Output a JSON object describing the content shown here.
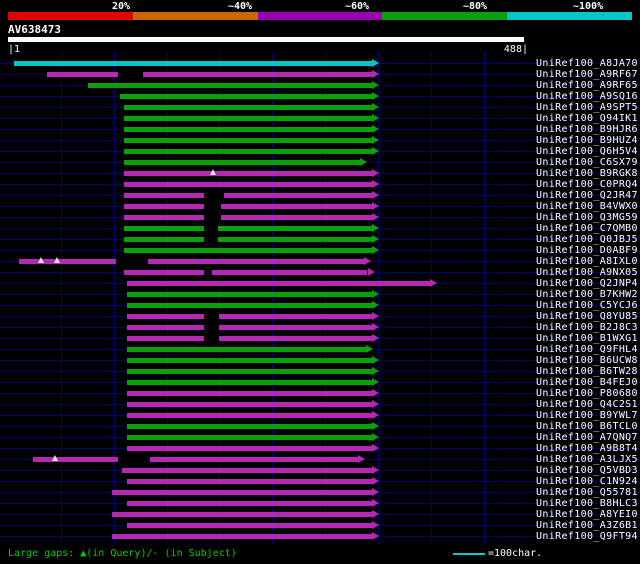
{
  "scale": {
    "labels": [
      "20%",
      "~40%",
      "~60%",
      "~80%",
      "~100%"
    ],
    "colors": [
      "#e00000",
      "#cc6600",
      "#9900b4",
      "#0aa00a",
      "#00c8c8"
    ]
  },
  "query": {
    "id": "AV638473",
    "ruler_left": "|1",
    "ruler_right": "488|"
  },
  "legend": {
    "gaps_note": "Large gaps: ▲(in Query)/- (in Subject)",
    "unit": "=100char."
  },
  "chart_data": {
    "type": "bar",
    "orientation": "horizontal",
    "title": "",
    "xlabel": "",
    "xlim": [
      0,
      488
    ],
    "bar_colors": {
      "cyan": "#00c8c8",
      "magenta": "#b428b4",
      "green": "#0aa00a"
    },
    "rows": [
      {
        "name": "UniRef100_A8JA70",
        "color": "cyan",
        "start": 6,
        "end": 344
      },
      {
        "name": "UniRef100_A9RF67",
        "color": "magenta",
        "start": 37,
        "end": 344,
        "gaps": [
          [
            104,
            128
          ]
        ]
      },
      {
        "name": "UniRef100_A9RF65",
        "color": "green",
        "start": 76,
        "end": 344
      },
      {
        "name": "UniRef100_A9SQ16",
        "color": "green",
        "start": 106,
        "end": 344
      },
      {
        "name": "UniRef100_A9SPT5",
        "color": "green",
        "start": 110,
        "end": 344
      },
      {
        "name": "UniRef100_Q94IK1",
        "color": "green",
        "start": 110,
        "end": 344
      },
      {
        "name": "UniRef100_B9HJR6",
        "color": "green",
        "start": 110,
        "end": 344
      },
      {
        "name": "UniRef100_B9HUZ4",
        "color": "green",
        "start": 110,
        "end": 344
      },
      {
        "name": "UniRef100_Q6H5V4",
        "color": "green",
        "start": 110,
        "end": 344
      },
      {
        "name": "UniRef100_C6SX79",
        "color": "green",
        "start": 110,
        "end": 333
      },
      {
        "name": "UniRef100_B9RGK8",
        "color": "magenta",
        "start": 110,
        "end": 344,
        "marks": [
          194
        ]
      },
      {
        "name": "UniRef100_C0PRQ4",
        "color": "magenta",
        "start": 110,
        "end": 344
      },
      {
        "name": "UniRef100_Q2JR47",
        "color": "magenta",
        "start": 110,
        "end": 344,
        "gaps": [
          [
            185,
            204
          ]
        ]
      },
      {
        "name": "UniRef100_B4VWX0",
        "color": "magenta",
        "start": 110,
        "end": 344,
        "gaps": [
          [
            185,
            201
          ]
        ]
      },
      {
        "name": "UniRef100_Q3MG59",
        "color": "magenta",
        "start": 110,
        "end": 344,
        "gaps": [
          [
            185,
            201
          ]
        ]
      },
      {
        "name": "UniRef100_C7QMB0",
        "color": "green",
        "start": 110,
        "end": 344,
        "gaps": [
          [
            185,
            199
          ]
        ]
      },
      {
        "name": "UniRef100_Q0JBJ5",
        "color": "green",
        "start": 110,
        "end": 344,
        "gaps": [
          [
            185,
            199
          ]
        ]
      },
      {
        "name": "UniRef100_D0ABF9",
        "color": "green",
        "start": 110,
        "end": 344
      },
      {
        "name": "UniRef100_A8IXL0",
        "color": "magenta",
        "start": 10,
        "end": 337,
        "gaps": [
          [
            102,
            132
          ]
        ],
        "marks": [
          31,
          46
        ]
      },
      {
        "name": "UniRef100_A9NX05",
        "color": "magenta",
        "start": 110,
        "end": 340,
        "gaps": [
          [
            185,
            193
          ]
        ]
      },
      {
        "name": "UniRef100_Q2JNP4",
        "color": "magenta",
        "start": 113,
        "end": 399
      },
      {
        "name": "UniRef100_B7KHW2",
        "color": "green",
        "start": 113,
        "end": 344
      },
      {
        "name": "UniRef100_C5YCJ6",
        "color": "green",
        "start": 113,
        "end": 344
      },
      {
        "name": "UniRef100_Q8YU85",
        "color": "magenta",
        "start": 113,
        "end": 344,
        "gaps": [
          [
            185,
            200
          ]
        ]
      },
      {
        "name": "UniRef100_B2J8C3",
        "color": "magenta",
        "start": 113,
        "end": 344,
        "gaps": [
          [
            185,
            200
          ]
        ]
      },
      {
        "name": "UniRef100_B1WXG1",
        "color": "magenta",
        "start": 113,
        "end": 344,
        "gaps": [
          [
            185,
            200
          ]
        ]
      },
      {
        "name": "UniRef100_Q9FHL4",
        "color": "green",
        "start": 113,
        "end": 339
      },
      {
        "name": "UniRef100_B6UCW8",
        "color": "green",
        "start": 113,
        "end": 344
      },
      {
        "name": "UniRef100_B6TW28",
        "color": "green",
        "start": 113,
        "end": 344
      },
      {
        "name": "UniRef100_B4FEJ0",
        "color": "green",
        "start": 113,
        "end": 344
      },
      {
        "name": "UniRef100_P80680",
        "color": "magenta",
        "start": 113,
        "end": 344
      },
      {
        "name": "UniRef100_Q4C2S1",
        "color": "magenta",
        "start": 113,
        "end": 344
      },
      {
        "name": "UniRef100_B9YWL7",
        "color": "magenta",
        "start": 113,
        "end": 344
      },
      {
        "name": "UniRef100_B6TCL0",
        "color": "green",
        "start": 113,
        "end": 344
      },
      {
        "name": "UniRef100_A7QNQ7",
        "color": "green",
        "start": 113,
        "end": 344
      },
      {
        "name": "UniRef100_A9B8T4",
        "color": "magenta",
        "start": 113,
        "end": 344
      },
      {
        "name": "UniRef100_A3LJX5",
        "color": "magenta",
        "start": 24,
        "end": 331,
        "gaps": [
          [
            104,
            134
          ]
        ],
        "marks": [
          44
        ]
      },
      {
        "name": "UniRef100_Q5VBD3",
        "color": "magenta",
        "start": 108,
        "end": 344
      },
      {
        "name": "UniRef100_C1N924",
        "color": "magenta",
        "start": 113,
        "end": 344
      },
      {
        "name": "UniRef100_Q55781",
        "color": "magenta",
        "start": 98,
        "end": 344
      },
      {
        "name": "UniRef100_B8HLC3",
        "color": "magenta",
        "start": 113,
        "end": 344
      },
      {
        "name": "UniRef100_A8YEI0",
        "color": "magenta",
        "start": 98,
        "end": 344
      },
      {
        "name": "UniRef100_A3Z6B1",
        "color": "magenta",
        "start": 113,
        "end": 344
      },
      {
        "name": "UniRef100_Q9FT94",
        "color": "magenta",
        "start": 98,
        "end": 344
      }
    ]
  }
}
